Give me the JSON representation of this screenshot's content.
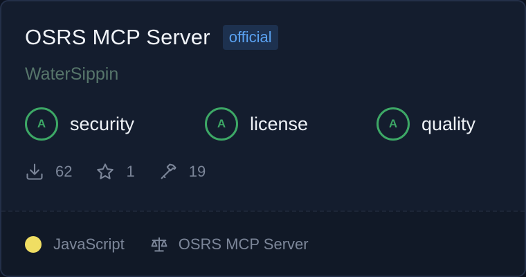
{
  "card": {
    "title": "OSRS MCP Server",
    "badge": "official",
    "author": "WaterSippin"
  },
  "grades": [
    {
      "grade": "A",
      "label": "security"
    },
    {
      "grade": "A",
      "label": "license"
    },
    {
      "grade": "A",
      "label": "quality"
    }
  ],
  "stats": {
    "downloads": "62",
    "stars": "1",
    "tools": "19"
  },
  "footer": {
    "language": "JavaScript",
    "license": "OSRS MCP Server"
  },
  "icons": {
    "downloads": "download-icon",
    "stars": "star-icon",
    "tools": "hammer-icon",
    "license": "scale-icon"
  },
  "colors": {
    "accent_badge": "#5aa2f2",
    "grade_green": "#3da866",
    "language_dot": "#f0de63"
  }
}
